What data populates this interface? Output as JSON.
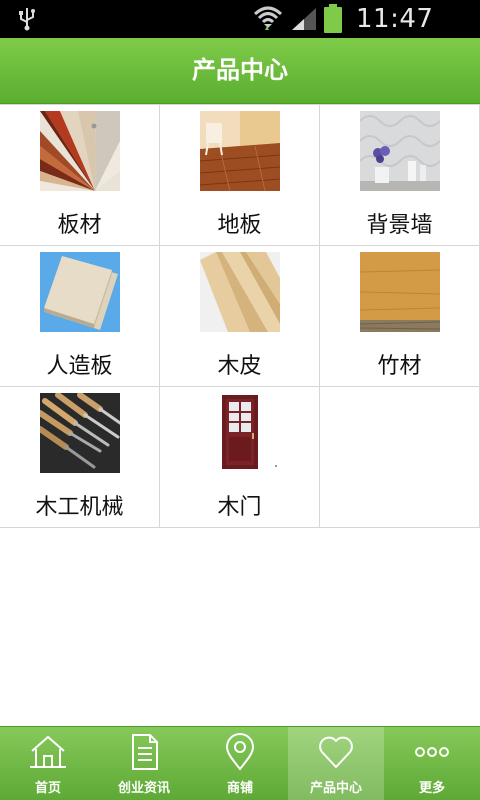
{
  "status_bar": {
    "time": "11:47 AM"
  },
  "header": {
    "title": "产品中心"
  },
  "products": [
    [
      {
        "label": "板材",
        "image": "color-swatch-fan"
      },
      {
        "label": "地板",
        "image": "wood-floor-room"
      },
      {
        "label": "背景墙",
        "image": "wallpaper-room"
      }
    ],
    [
      {
        "label": "人造板",
        "image": "board-stack"
      },
      {
        "label": "木皮",
        "image": "wood-veneer-planks"
      },
      {
        "label": "竹材",
        "image": "particle-board"
      }
    ],
    [
      {
        "label": "木工机械",
        "image": "chisel-set"
      },
      {
        "label": "木门",
        "image": "wooden-door"
      }
    ]
  ],
  "bottom_nav": [
    {
      "label": "首页",
      "icon": "home-icon"
    },
    {
      "label": "创业资讯",
      "icon": "document-icon"
    },
    {
      "label": "商铺",
      "icon": "location-pin-icon"
    },
    {
      "label": "产品中心",
      "icon": "heart-icon",
      "active": true
    },
    {
      "label": "更多",
      "icon": "more-dots-icon"
    }
  ],
  "colors": {
    "header_green": "#6cbd3c",
    "nav_green": "#71b846",
    "status_bar": "#000000"
  }
}
